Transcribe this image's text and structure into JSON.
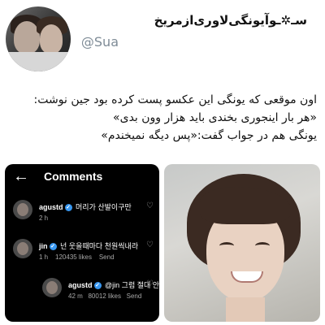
{
  "header": {
    "display_name": "سـ✲ـوآیونگی‌لاوری‌ازمریخ",
    "handle": "@Sua"
  },
  "tweet": {
    "lines": [
      "اون موقعی که یونگی این عکسو پست کرده بود جین نوشت:",
      "«هر بار اینجوری بخندی باید هزار وون بدی»",
      "یونگی هم در جواب گفت:«پس دیگه نمیخندم»"
    ]
  },
  "screenshot": {
    "title": "Comments",
    "back_icon": "arrow-left-icon",
    "comments": [
      {
        "user": "agustd",
        "verified": true,
        "text": "머리가 산발이구만",
        "time": "2 h",
        "likes": "",
        "reply": ""
      },
      {
        "user": "jin",
        "verified": true,
        "text": "넌 웃을때마다 천원씩내라",
        "time": "1 h",
        "likes": "120435 likes",
        "reply": "Send"
      },
      {
        "user": "agustd",
        "verified": true,
        "text": "@jin 그럼 절대 안",
        "time": "42 m",
        "likes": "80012 likes",
        "reply": "Send"
      }
    ]
  },
  "colors": {
    "handle": "#7f8c97",
    "verified": "#3897f0",
    "screenshot_bg": "#000000"
  }
}
